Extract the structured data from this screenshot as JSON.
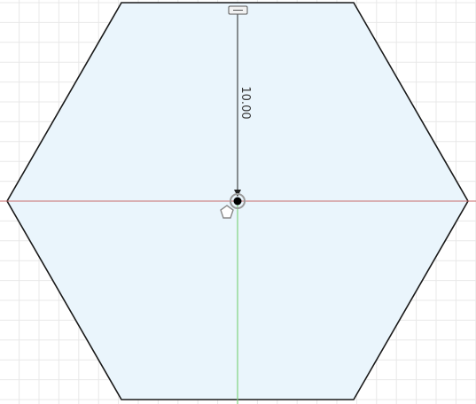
{
  "sketch": {
    "dimension_label": "10.00",
    "shape": "hexagon",
    "tool_icon": "pentagon-icon",
    "colors": {
      "background": "#ffffff",
      "grid": "#e8e8e8",
      "hexagon_fill": "#eaf5fc",
      "hexagon_stroke": "#1a1a1a",
      "x_axis": "#c86a6a",
      "y_axis": "#7fd27f",
      "dimension_line": "#222222",
      "center_point": "#000000"
    }
  }
}
